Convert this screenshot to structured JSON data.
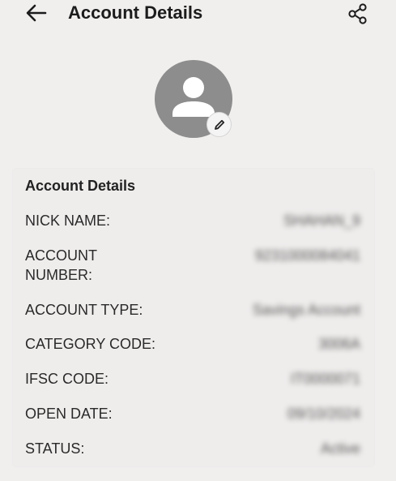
{
  "header": {
    "title": "Account Details",
    "back_icon": "arrow-left-icon",
    "share_icon": "share-icon"
  },
  "profile": {
    "avatar_icon": "user-avatar-icon",
    "edit_icon": "pencil-icon"
  },
  "section": {
    "title": "Account Details",
    "rows": [
      {
        "label": "NICK NAME:",
        "value": "SHAHAN_9"
      },
      {
        "label_line1": "ACCOUNT",
        "label_line2": "NUMBER:",
        "value": "9231000084041"
      },
      {
        "label": "ACCOUNT TYPE:",
        "value": "Savings Account"
      },
      {
        "label": "CATEGORY CODE:",
        "value": "3006A"
      },
      {
        "label": "IFSC CODE:",
        "value": "IT0000071"
      },
      {
        "label": "OPEN DATE:",
        "value": "09/10/2024"
      },
      {
        "label": "STATUS:",
        "value": "Active"
      }
    ]
  },
  "colors": {
    "background": "#f1efee",
    "avatar": "#8d8d8d"
  }
}
